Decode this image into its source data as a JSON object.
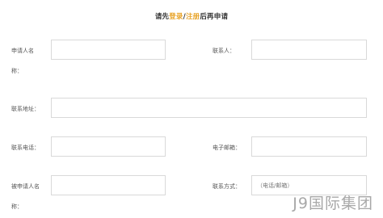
{
  "notice": {
    "prefix": "请先",
    "login_link": "登录",
    "separator": "/",
    "register_link": "注册",
    "suffix": "后再申请"
  },
  "form": {
    "applicant_name_label_line1": "申请人名",
    "applicant_name_label_line2": "称：",
    "applicant_name_value": "",
    "contact_person_label": "联系人：",
    "contact_person_value": "",
    "address_label": "联系地址：",
    "address_value": "",
    "phone_label": "联系电话：",
    "phone_value": "",
    "email_label": "电子邮箱：",
    "email_value": "",
    "respondent_name_label_line1": "被申请人名",
    "respondent_name_label_line2": "称：",
    "respondent_name_value": "",
    "contact_method_label": "联系方式：",
    "contact_method_placeholder": "（电话/邮箱）",
    "contact_method_value": ""
  },
  "watermark": {
    "text": "J9国际集团"
  },
  "colors": {
    "accent": "#e8a42a",
    "border": "#d9d9d9",
    "label": "#555555",
    "watermark": "#a8a8a8"
  }
}
